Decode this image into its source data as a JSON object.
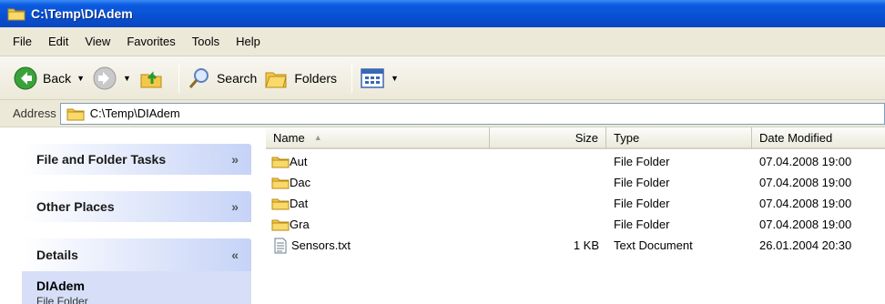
{
  "window": {
    "title": "C:\\Temp\\DIAdem"
  },
  "menu": [
    "File",
    "Edit",
    "View",
    "Favorites",
    "Tools",
    "Help"
  ],
  "toolbar": {
    "back_label": "Back",
    "search_label": "Search",
    "folders_label": "Folders"
  },
  "address": {
    "label": "Address",
    "value": "C:\\Temp\\DIAdem"
  },
  "left_pane": {
    "panels": [
      {
        "title": "File and Folder Tasks",
        "chevron": "»"
      },
      {
        "title": "Other Places",
        "chevron": "»"
      },
      {
        "title": "Details",
        "chevron": "«"
      }
    ],
    "details": {
      "name": "DIAdem",
      "type": "File Folder"
    }
  },
  "columns": {
    "name": "Name",
    "size": "Size",
    "type": "Type",
    "date": "Date Modified",
    "sort_indicator": "▲"
  },
  "files": [
    {
      "name": "Aut",
      "size": "",
      "type": "File Folder",
      "date": "07.04.2008 19:00",
      "icon": "folder-icon"
    },
    {
      "name": "Dac",
      "size": "",
      "type": "File Folder",
      "date": "07.04.2008 19:00",
      "icon": "folder-icon"
    },
    {
      "name": "Dat",
      "size": "",
      "type": "File Folder",
      "date": "07.04.2008 19:00",
      "icon": "folder-icon"
    },
    {
      "name": "Gra",
      "size": "",
      "type": "File Folder",
      "date": "07.04.2008 19:00",
      "icon": "folder-icon"
    },
    {
      "name": "Sensors.txt",
      "size": "1 KB",
      "type": "Text Document",
      "date": "26.01.2004 20:30",
      "icon": "text-file-icon"
    }
  ],
  "colors": {
    "titlebar": "#0850d1",
    "chrome": "#ece9d8",
    "panel_gradient_end": "#c6d3f7"
  }
}
